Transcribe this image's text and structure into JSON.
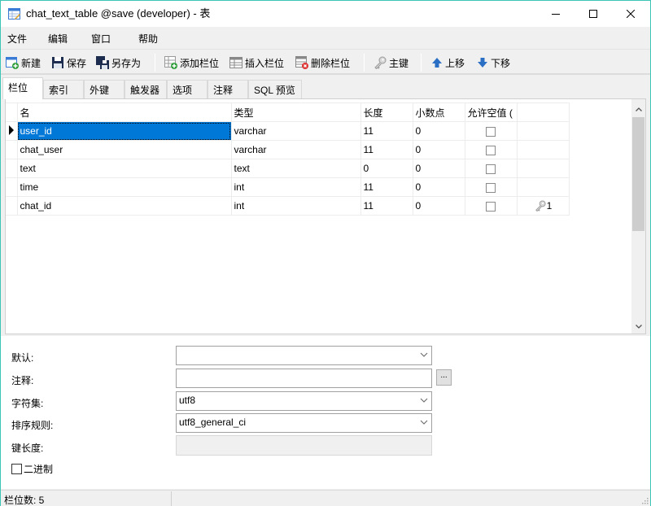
{
  "window": {
    "title": "chat_text_table @save (developer) - 表",
    "controls": {
      "minimize": "minimize",
      "maximize": "maximize",
      "close": "close"
    }
  },
  "menu": [
    "文件",
    "编辑",
    "窗口",
    "帮助"
  ],
  "toolbar": {
    "new": "新建",
    "save": "保存",
    "save_as": "另存为",
    "add_field": "添加栏位",
    "insert_field": "插入栏位",
    "delete_field": "删除栏位",
    "primary_key": "主键",
    "move_up": "上移",
    "move_down": "下移"
  },
  "tabs": [
    "栏位",
    "索引",
    "外键",
    "触发器",
    "选项",
    "注释",
    "SQL 预览"
  ],
  "active_tab": "栏位",
  "grid": {
    "columns": [
      "名",
      "类型",
      "长度",
      "小数点",
      "允许空值 (",
      ""
    ],
    "rows": [
      {
        "name": "user_id",
        "type": "varchar",
        "length": "11",
        "decimals": "0",
        "allow_null": false,
        "key": "",
        "selected": true
      },
      {
        "name": "chat_user",
        "type": "varchar",
        "length": "11",
        "decimals": "0",
        "allow_null": false,
        "key": ""
      },
      {
        "name": "text",
        "type": "text",
        "length": "0",
        "decimals": "0",
        "allow_null": false,
        "key": ""
      },
      {
        "name": "time",
        "type": "int",
        "length": "11",
        "decimals": "0",
        "allow_null": false,
        "key": ""
      },
      {
        "name": "chat_id",
        "type": "int",
        "length": "11",
        "decimals": "0",
        "allow_null": false,
        "key": "1"
      }
    ]
  },
  "properties": {
    "default_label": "默认:",
    "default_value": "",
    "comment_label": "注释:",
    "comment_value": "",
    "comment_button": "...",
    "charset_label": "字符集:",
    "charset_value": "utf8",
    "collation_label": "排序规则:",
    "collation_value": "utf8_general_ci",
    "key_length_label": "键长度:",
    "key_length_value": "",
    "binary_label": "二进制",
    "binary_checked": false
  },
  "status": {
    "field_count": "栏位数: 5"
  },
  "colors": {
    "selection": "#0078d7",
    "window_border": "#3cc4b4"
  }
}
